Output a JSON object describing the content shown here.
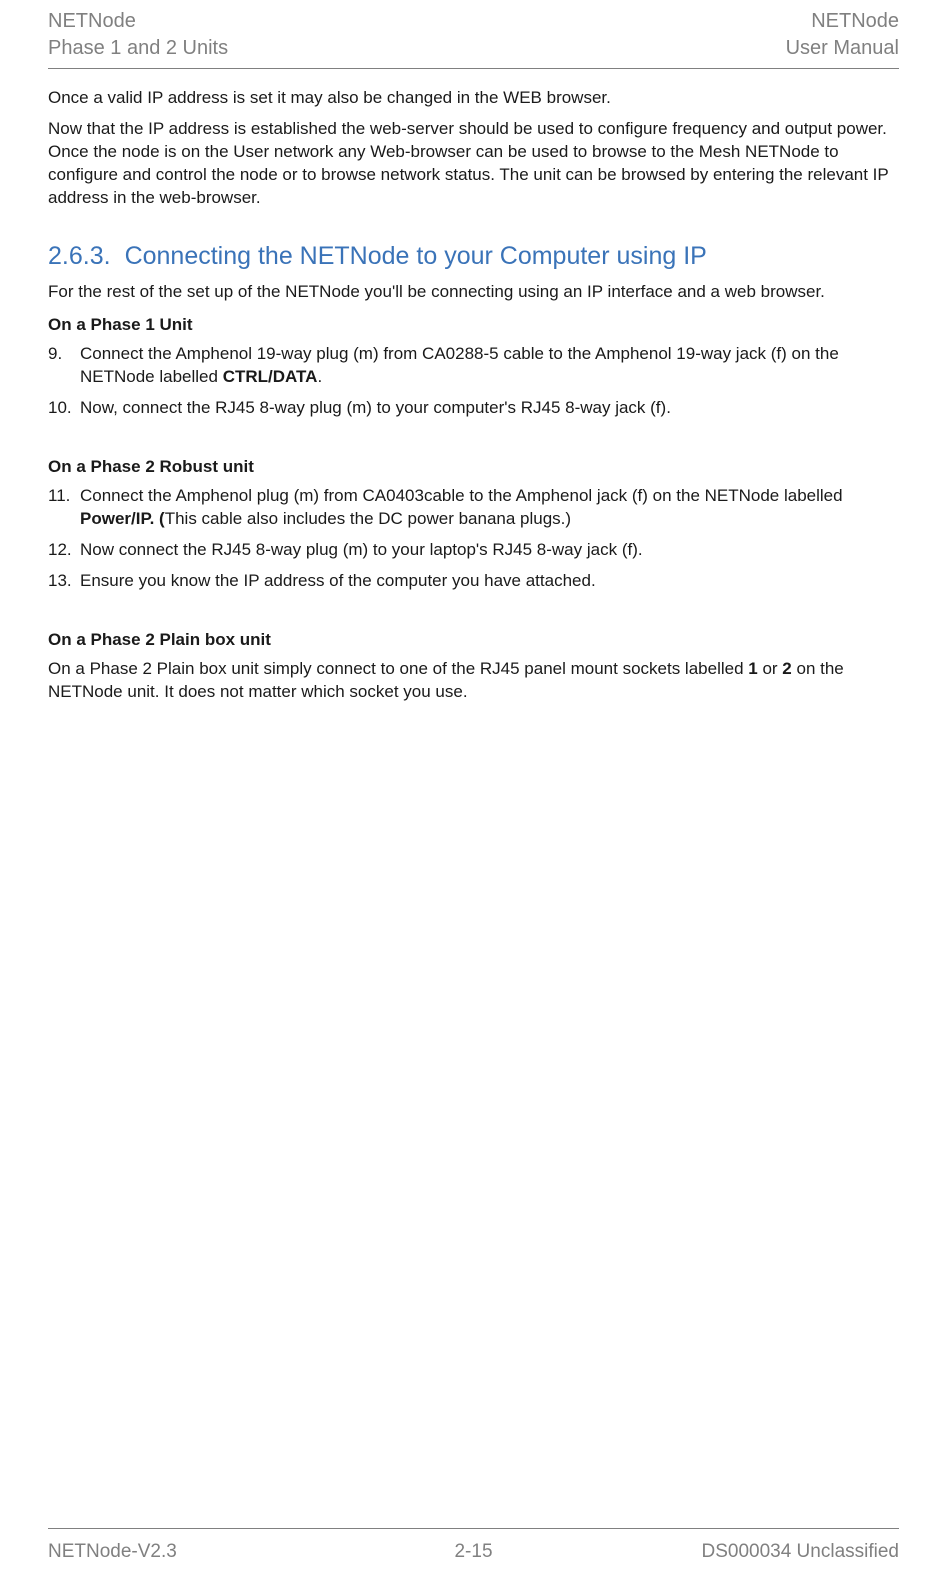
{
  "header": {
    "left_line1": "NETNode",
    "left_line2": "Phase 1 and 2 Units",
    "right_line1": "NETNode",
    "right_line2": "User Manual"
  },
  "body": {
    "p1": "Once a valid IP address is set it may also be changed in the WEB browser.",
    "p2": "Now that the IP address is established the web-server should be used to configure frequency and output power. Once the node is on the User network any Web-browser can be used to browse to the Mesh NETNode to configure and control the node or to browse network status. The unit can be browsed by entering the relevant IP address in the web-browser.",
    "section_num": "2.6.3.",
    "section_title": "Connecting the NETNode to your Computer using IP",
    "p3": "For the rest of the set up of the NETNode you'll be connecting using an IP interface and a web browser.",
    "sub1": "On a Phase 1 Unit",
    "li9_marker": "9.",
    "li9_a": "Connect the Amphenol 19-way plug (m) from CA0288-5 cable to the Amphenol 19-way jack (f) on the NETNode labelled ",
    "li9_b": "CTRL/DATA",
    "li9_c": ".",
    "li10_marker": "10.",
    "li10": "Now, connect the RJ45 8-way plug (m) to your computer's RJ45 8-way jack (f).",
    "sub2": "On a Phase 2 Robust unit",
    "li11_marker": "11.",
    "li11_a": "Connect the Amphenol plug (m) from CA0403cable to the Amphenol jack (f) on the NETNode labelled ",
    "li11_b": "Power/IP. (",
    "li11_c": "This cable also includes the DC power banana plugs.)",
    "li12_marker": "12.",
    "li12": "Now connect the RJ45 8-way plug (m) to your laptop's RJ45 8-way jack (f).",
    "li13_marker": "13.",
    "li13": "Ensure you know the IP address of the computer you have attached.",
    "sub3": "On a Phase 2 Plain box unit",
    "p4_a": "On a Phase 2 Plain box unit simply connect to one of the RJ45 panel mount sockets labelled ",
    "p4_b": "1",
    "p4_c": " or ",
    "p4_d": "2",
    "p4_e": " on the NETNode unit. It does not matter which socket you use."
  },
  "footer": {
    "left": "NETNode-V2.3",
    "center": "2-15",
    "right": "DS000034 Unclassified"
  }
}
